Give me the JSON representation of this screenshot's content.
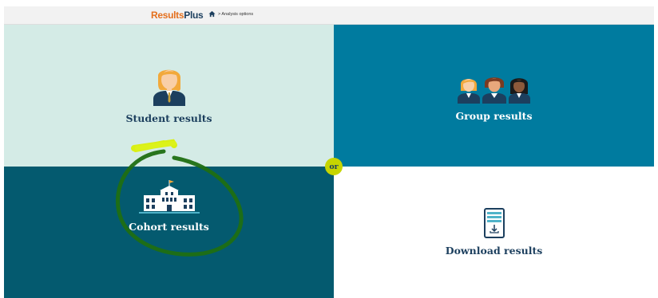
{
  "header": {
    "logo_part1": "Results",
    "logo_part2": "Plus",
    "breadcrumb": "> Analysis options"
  },
  "tiles": [
    {
      "label": "Student results",
      "icon": "student-icon"
    },
    {
      "label": "Group results",
      "icon": "group-icon"
    },
    {
      "label": "Cohort results",
      "icon": "school-building-icon"
    },
    {
      "label": "Download results",
      "icon": "tablet-download-icon"
    }
  ],
  "or_badge": "or",
  "colors": {
    "student_bg": "#d4ebe6",
    "group_bg": "#007b9f",
    "cohort_bg": "#045a6f",
    "download_bg": "#ffffff",
    "accent": "#c6d500",
    "navy": "#1c3f5e",
    "logo_orange": "#e4701e"
  }
}
